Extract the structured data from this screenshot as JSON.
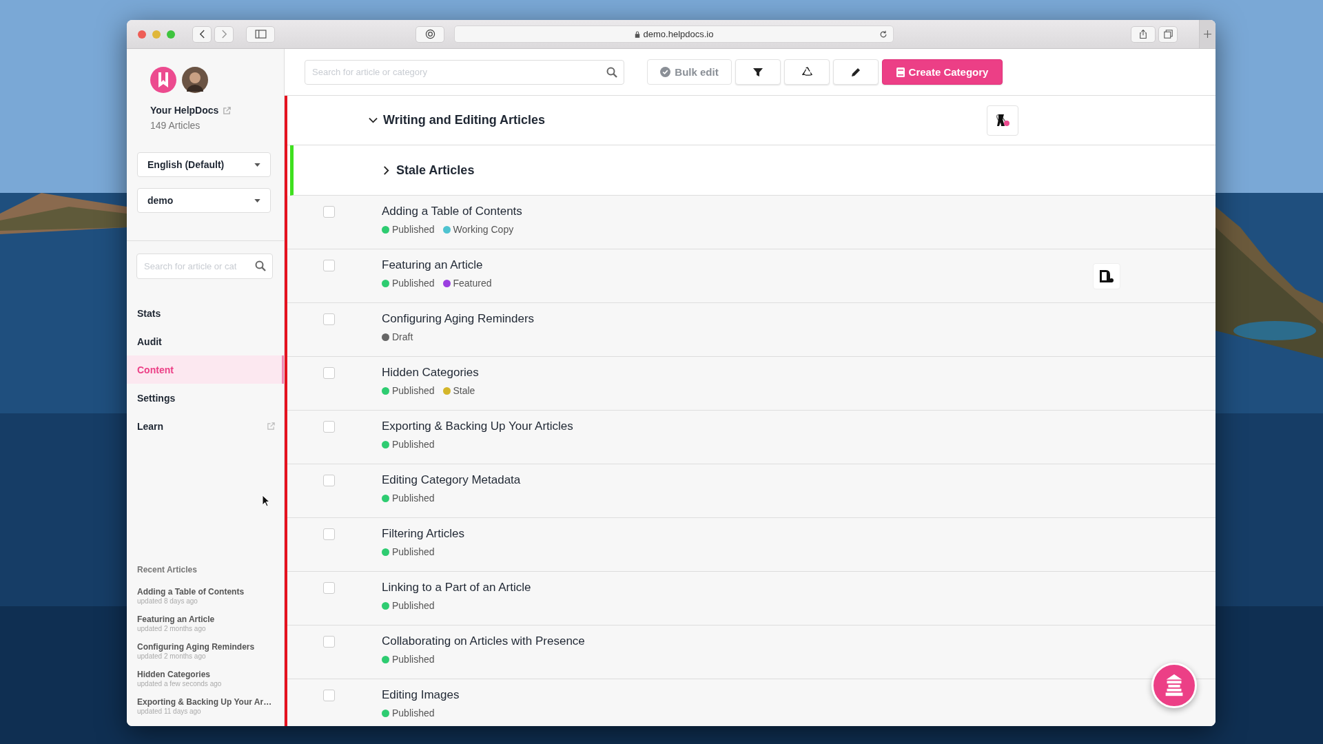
{
  "browser": {
    "url": "demo.helpdocs.io"
  },
  "sidebar": {
    "site_name": "Your HelpDocs",
    "article_count": "149 Articles",
    "language": "English (Default)",
    "workspace": "demo",
    "search": {
      "placeholder": "Search for article or cat"
    },
    "nav": [
      {
        "label": "Stats",
        "selected": false,
        "external": false
      },
      {
        "label": "Audit",
        "selected": false,
        "external": false
      },
      {
        "label": "Content",
        "selected": true,
        "external": false
      },
      {
        "label": "Settings",
        "selected": false,
        "external": false
      },
      {
        "label": "Learn",
        "selected": false,
        "external": true
      }
    ],
    "recent": {
      "title": "Recent Articles",
      "items": [
        {
          "title": "Adding a Table of Contents",
          "updated": "updated 8 days ago"
        },
        {
          "title": "Featuring an Article",
          "updated": "updated 2 months ago"
        },
        {
          "title": "Configuring Aging Reminders",
          "updated": "updated 2 months ago"
        },
        {
          "title": "Hidden Categories",
          "updated": "updated a few seconds ago"
        },
        {
          "title": "Exporting & Backing Up Your Ar…",
          "updated": "updated 11 days ago"
        }
      ]
    }
  },
  "toolbar": {
    "search": {
      "placeholder": "Search for article or category"
    },
    "bulk_edit": "Bulk edit",
    "create": "Create Category"
  },
  "category": {
    "title": "Writing and Editing Articles",
    "expanded": true,
    "subcategories": [
      {
        "title": "Stale Articles",
        "expanded": false
      }
    ],
    "articles": [
      {
        "title": "Adding a Table of Contents",
        "checked": false,
        "tool_icon": false,
        "statuses": [
          {
            "label": "Published",
            "color": "#2ecc71"
          },
          {
            "label": "Working Copy",
            "color": "#4ec3d0"
          }
        ]
      },
      {
        "title": "Featuring an Article",
        "checked": false,
        "tool_icon": true,
        "statuses": [
          {
            "label": "Published",
            "color": "#2ecc71"
          },
          {
            "label": "Featured",
            "color": "#9b3fe0"
          }
        ]
      },
      {
        "title": "Configuring Aging Reminders",
        "checked": false,
        "tool_icon": false,
        "statuses": [
          {
            "label": "Draft",
            "color": "#666666"
          }
        ]
      },
      {
        "title": "Hidden Categories",
        "checked": false,
        "tool_icon": false,
        "statuses": [
          {
            "label": "Published",
            "color": "#2ecc71"
          },
          {
            "label": "Stale",
            "color": "#d4b62a"
          }
        ]
      },
      {
        "title": "Exporting & Backing Up Your Articles",
        "checked": false,
        "tool_icon": false,
        "statuses": [
          {
            "label": "Published",
            "color": "#2ecc71"
          }
        ]
      },
      {
        "title": "Editing Category Metadata",
        "checked": false,
        "tool_icon": false,
        "statuses": [
          {
            "label": "Published",
            "color": "#2ecc71"
          }
        ]
      },
      {
        "title": "Filtering Articles",
        "checked": false,
        "tool_icon": false,
        "statuses": [
          {
            "label": "Published",
            "color": "#2ecc71"
          }
        ]
      },
      {
        "title": "Linking to a Part of an Article",
        "checked": false,
        "tool_icon": false,
        "statuses": [
          {
            "label": "Published",
            "color": "#2ecc71"
          }
        ]
      },
      {
        "title": "Collaborating on Articles with Presence",
        "checked": false,
        "tool_icon": false,
        "statuses": [
          {
            "label": "Published",
            "color": "#2ecc71"
          }
        ]
      },
      {
        "title": "Editing Images",
        "checked": false,
        "tool_icon": false,
        "statuses": [
          {
            "label": "Published",
            "color": "#2ecc71"
          }
        ]
      }
    ]
  }
}
